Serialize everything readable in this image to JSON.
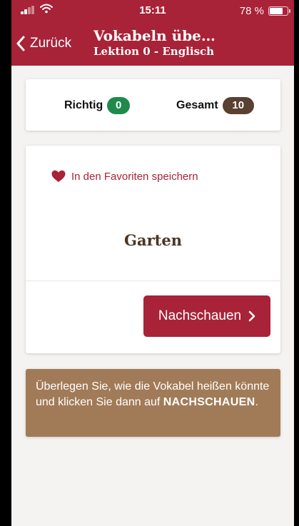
{
  "status_bar": {
    "time": "15:11",
    "battery_percent": "78 %",
    "battery_level": 0.78,
    "signal_icon": "cellular-signal-icon",
    "wifi_icon": "wifi-icon",
    "battery_icon": "battery-icon"
  },
  "nav": {
    "back_label": "Zurück",
    "back_icon": "chevron-left-icon",
    "title": "Vokabeln übe…",
    "subtitle": "Lektion 0 - Englisch"
  },
  "score": {
    "correct_label": "Richtig",
    "correct_value": "0",
    "total_label": "Gesamt",
    "total_value": "10"
  },
  "vocab": {
    "favorite_label": "In den Favoriten speichern",
    "favorite_icon": "heart-icon",
    "word": "Garten",
    "lookup_label": "Nachschauen",
    "lookup_icon": "chevron-right-icon"
  },
  "hint": {
    "text_before": "Überlegen Sie, wie die Vokabel heißen könnte und klicken Sie dann auf ",
    "emphasis": "NACHSCHAUEN",
    "text_after": "."
  },
  "colors": {
    "brand": "#a82238",
    "correct_badge": "#1f8a4c",
    "total_badge": "#5a4030",
    "hint_background": "#a17b58",
    "word_text": "#4a3626"
  }
}
